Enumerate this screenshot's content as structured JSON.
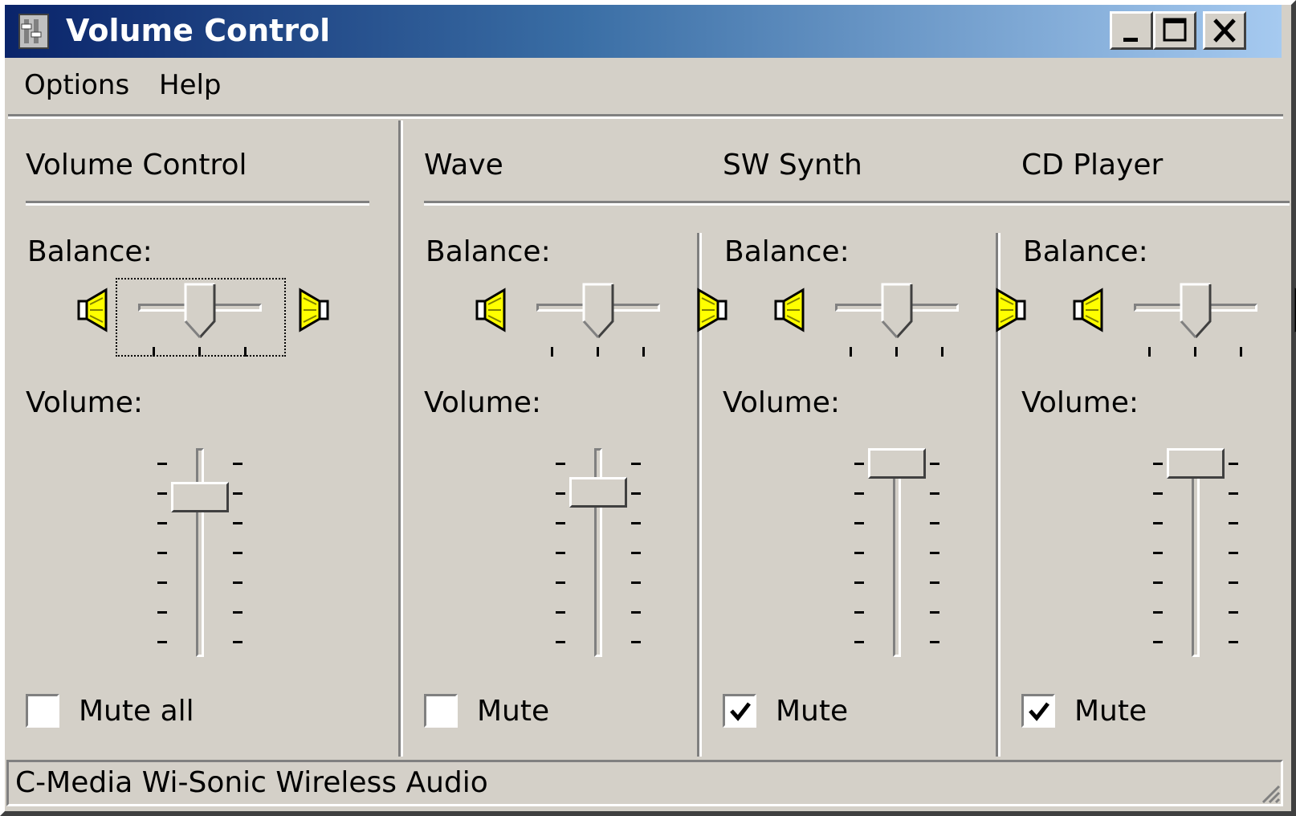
{
  "window": {
    "title": "Volume Control",
    "icon": "speaker-app-icon"
  },
  "caption_buttons": {
    "minimize": "minimize-icon",
    "maximize": "maximize-icon",
    "close": "close-icon"
  },
  "menu": {
    "items": [
      {
        "label": "Options"
      },
      {
        "label": "Help"
      }
    ]
  },
  "channels": [
    {
      "title": "Volume Control",
      "balance_label": "Balance:",
      "volume_label": "Volume:",
      "mute_label": "Mute all",
      "mute_checked": false,
      "balance": 0.5,
      "volume": 0.81
    },
    {
      "title": "Wave",
      "balance_label": "Balance:",
      "volume_label": "Volume:",
      "mute_label": "Mute",
      "mute_checked": false,
      "balance": 0.5,
      "volume": 0.84
    },
    {
      "title": "SW Synth",
      "balance_label": "Balance:",
      "volume_label": "Volume:",
      "mute_label": "Mute",
      "mute_checked": true,
      "balance": 0.5,
      "volume": 1.0
    },
    {
      "title": "CD Player",
      "balance_label": "Balance:",
      "volume_label": "Volume:",
      "mute_label": "Mute",
      "mute_checked": true,
      "balance": 0.5,
      "volume": 1.0
    }
  ],
  "status": {
    "device": "C-Media Wi-Sonic Wireless Audio"
  },
  "colors": {
    "face": "#d4d0c8",
    "title_start": "#0a246a",
    "title_end": "#a6caf0",
    "speaker_yellow": "#ffff00"
  }
}
